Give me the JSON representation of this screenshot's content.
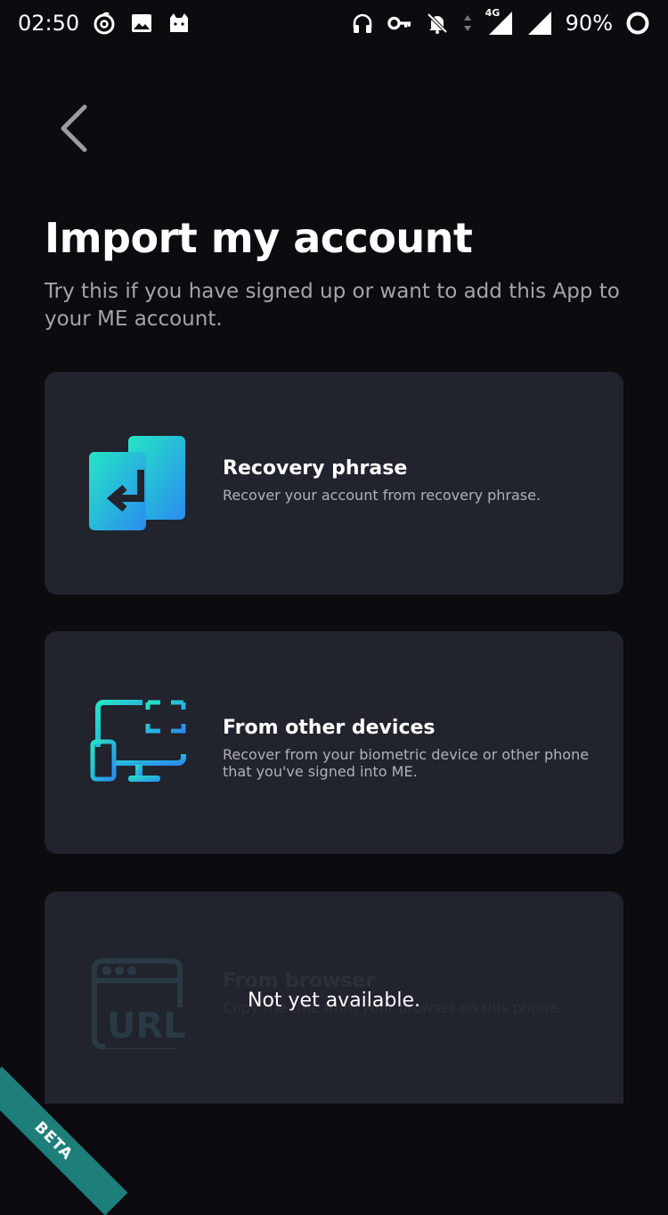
{
  "status_bar": {
    "time": "02:50",
    "left_icons": [
      "netease-music-icon",
      "image-icon",
      "cat-icon"
    ],
    "right_icons": [
      "headphones-icon",
      "vpn-key-icon",
      "notifications-off-icon",
      "data-arrows-icon",
      "signal-4g-icon",
      "signal-icon"
    ],
    "network_label": "4G",
    "battery": "90%"
  },
  "header": {
    "back_icon": "chevron-left-icon",
    "title": "Import my account",
    "subtitle": "Try this if you have signed up or want to add this App to your ME account."
  },
  "options": [
    {
      "icon": "recovery-phrase-icon",
      "title": "Recovery phrase",
      "description": "Recover your account from recovery phrase."
    },
    {
      "icon": "devices-icon",
      "title": "From other devices",
      "description": "Recover from your biometric device or other phone that you've signed into ME."
    },
    {
      "icon": "browser-url-icon",
      "title": "From browser",
      "description": "Copy the URL from your browser on this phone.",
      "url_label": "URL"
    }
  ],
  "toast": "Not yet available.",
  "badge": "BETA",
  "colors": {
    "background": "#0b0b10",
    "card": "#21232d",
    "accent_start": "#25e5c4",
    "accent_end": "#2a8cf0",
    "beta": "#1e7f7a"
  }
}
